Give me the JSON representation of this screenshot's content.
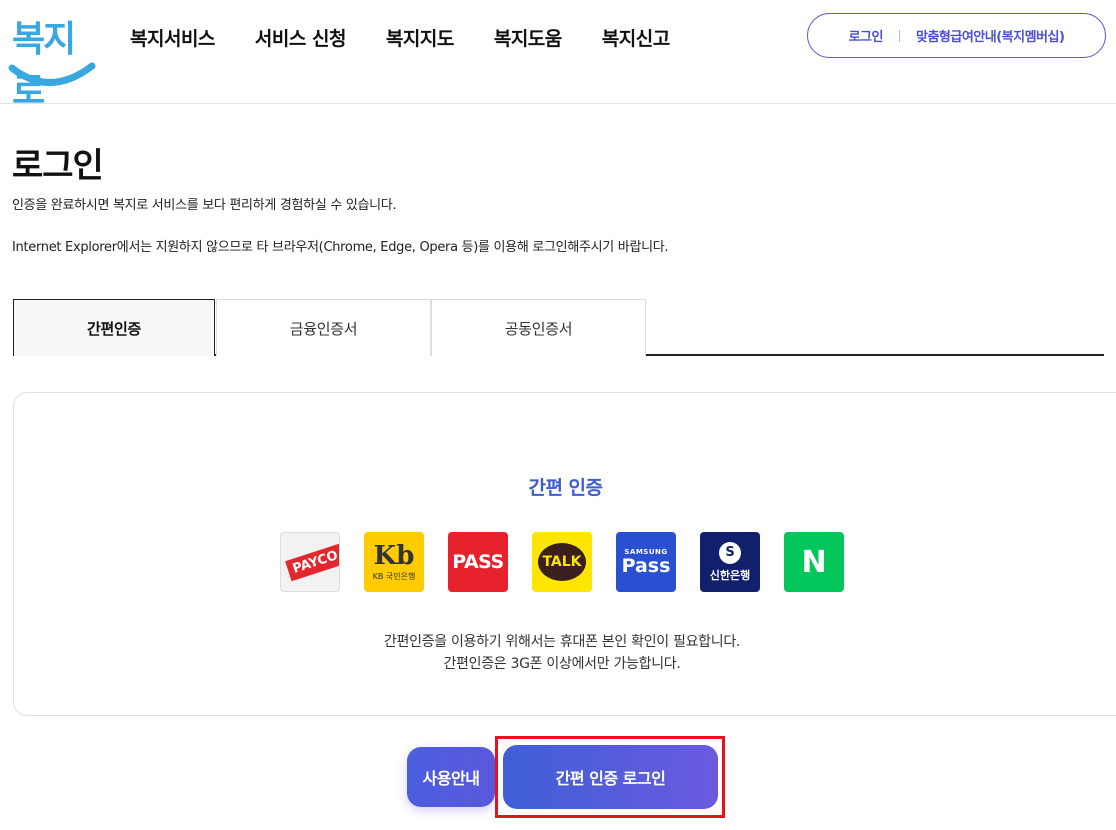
{
  "header": {
    "logo_text": "복지로",
    "nav": [
      "복지서비스",
      "서비스 신청",
      "복지지도",
      "복지도움",
      "복지신고"
    ],
    "util": {
      "login": "로그인",
      "membership": "맞춤형급여안내(복지멤버십)"
    }
  },
  "page": {
    "title": "로그인",
    "desc1": "인증을 완료하시면 복지로 서비스를 보다 편리하게 경험하실 수 있습니다.",
    "desc2": "Internet Explorer에서는 지원하지 않으므로 타 브라우저(Chrome, Edge, Opera 등)를 이용해 로그인해주시기 바랍니다."
  },
  "tabs": [
    {
      "label": "간편인증",
      "active": true
    },
    {
      "label": "금융인증서",
      "active": false
    },
    {
      "label": "공동인증서",
      "active": false
    }
  ],
  "panel": {
    "title": "간편 인증",
    "providers": [
      {
        "name": "PAYCO",
        "text": "PAYCO"
      },
      {
        "name": "KB국민은행",
        "text": "Kb",
        "sub": "KB 국민은행"
      },
      {
        "name": "PASS",
        "text": "PASS"
      },
      {
        "name": "카카오톡",
        "text": "TALK"
      },
      {
        "name": "SAMSUNG Pass",
        "top": "SAMSUNG",
        "text": "Pass"
      },
      {
        "name": "신한은행",
        "text": "신한은행"
      },
      {
        "name": "네이버",
        "text": "N"
      }
    ],
    "note1": "간편인증을 이용하기 위해서는 휴대폰 본인 확인이 필요합니다.",
    "note2": "간편인증은 3G폰 이상에서만 가능합니다."
  },
  "buttons": {
    "guide": "사용안내",
    "login": "간편 인증 로그인"
  },
  "colors": {
    "accent": "#3d5ccf",
    "highlight": "#e8121c",
    "logo": "#3aa8e0"
  }
}
